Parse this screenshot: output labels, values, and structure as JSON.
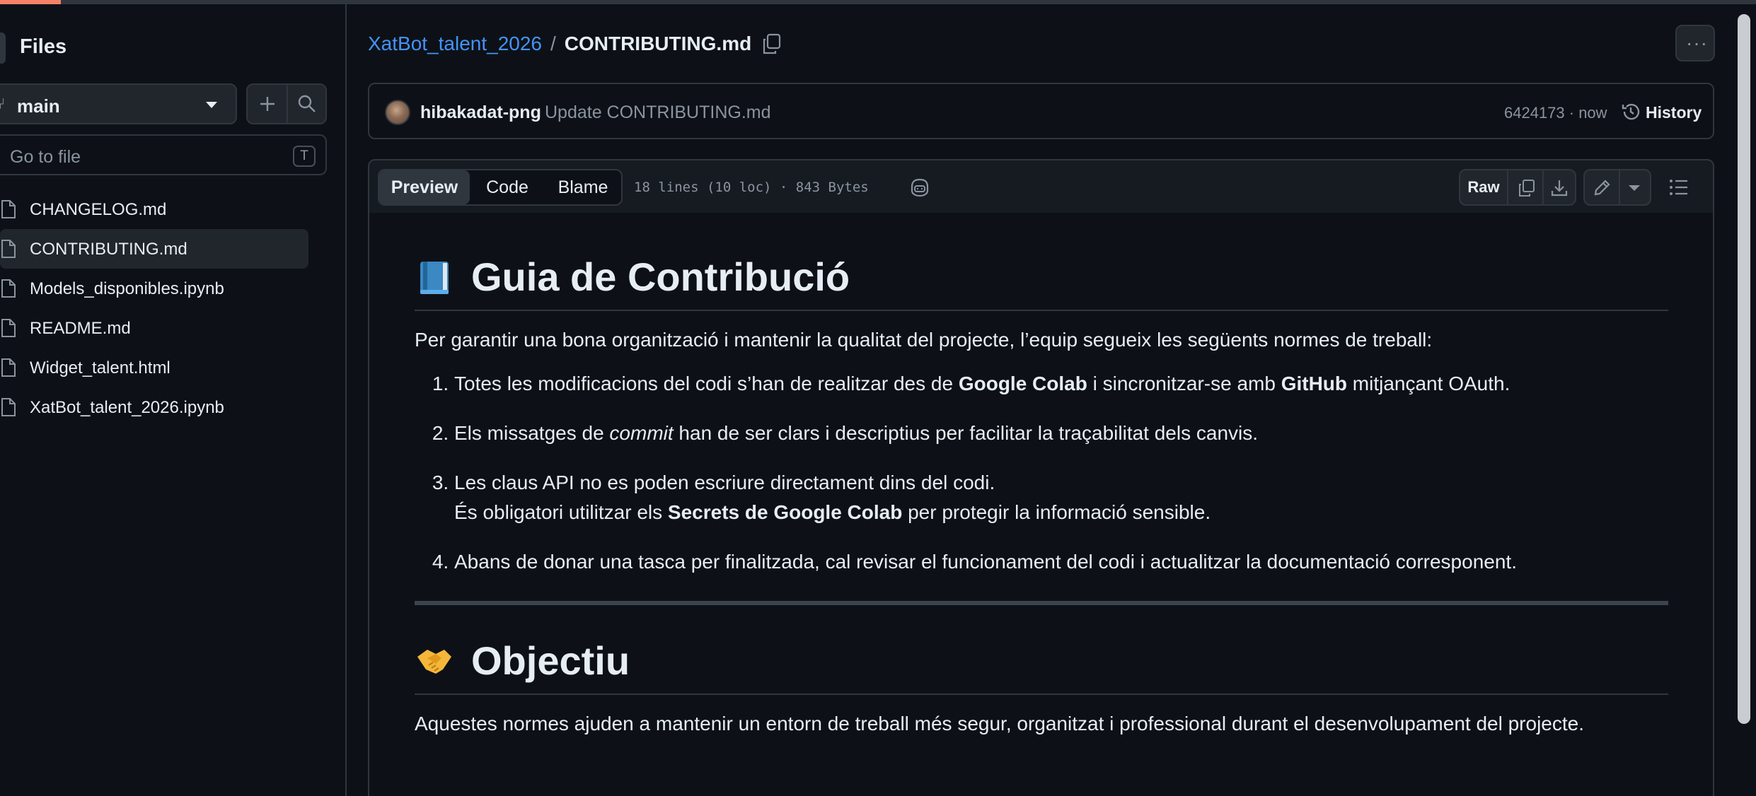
{
  "sidebar": {
    "title": "Files",
    "branch": "main",
    "goto_placeholder": "Go to file",
    "goto_shortcut": "T",
    "files": [
      {
        "name": "CHANGELOG.md",
        "active": false
      },
      {
        "name": "CONTRIBUTING.md",
        "active": true
      },
      {
        "name": "Models_disponibles.ipynb",
        "active": false
      },
      {
        "name": "README.md",
        "active": false
      },
      {
        "name": "Widget_talent.html",
        "active": false
      },
      {
        "name": "XatBot_talent_2026.ipynb",
        "active": false
      }
    ]
  },
  "breadcrumb": {
    "repo": "XatBot_talent_2026",
    "separator": "/",
    "file": "CONTRIBUTING.md"
  },
  "commit": {
    "author": "hibakadat-png",
    "message": "Update CONTRIBUTING.md",
    "meta": "6424173 · now",
    "history_label": "History"
  },
  "file_header": {
    "tabs": [
      "Preview",
      "Code",
      "Blame"
    ],
    "active_tab": "Preview",
    "info": "18 lines (10 loc) · 843 Bytes",
    "raw_label": "Raw",
    "icons": [
      "copilot-icon",
      "copy-icon",
      "download-icon",
      "pencil-icon",
      "outline-icon"
    ]
  },
  "markdown": {
    "h1": "Guia de Contribució",
    "h1_emoji": "blue-book",
    "intro": "Per garantir una bona organització i mantenir la qualitat del projecte, l’equip segueix les següents normes de treball:",
    "items": {
      "i1": {
        "a": "Totes les modificacions del codi s’han de realitzar des de ",
        "b1": "Google Colab",
        "c": " i sincronitzar-se amb ",
        "b2": "GitHub",
        "d": " mitjançant OAuth."
      },
      "i2": {
        "a": "Els missatges de ",
        "em": "commit",
        "b": " han de ser clars i descriptius per facilitar la traçabilitat dels canvis."
      },
      "i3": {
        "line1": "Les claus API no es poden escriure directament dins del codi.",
        "a": "És obligatori utilitzar els ",
        "b": "Secrets de Google Colab",
        "c": " per protegir la informació sensible."
      },
      "i4": {
        "text": "Abans de donar una tasca per finalitzada, cal revisar el funcionament del codi i actualitzar la documentació corresponent."
      }
    },
    "h2": "Objectiu",
    "h2_emoji": "handshake",
    "outro": "Aquestes normes ajuden a mantenir un entorn de treball més segur, organitzat i professional durant el desenvolupament del projecte."
  },
  "colors": {
    "background": "#0d1117",
    "link": "#4493f8",
    "border": "#30363d",
    "muted": "#8b949e",
    "accent": "#f78166"
  }
}
